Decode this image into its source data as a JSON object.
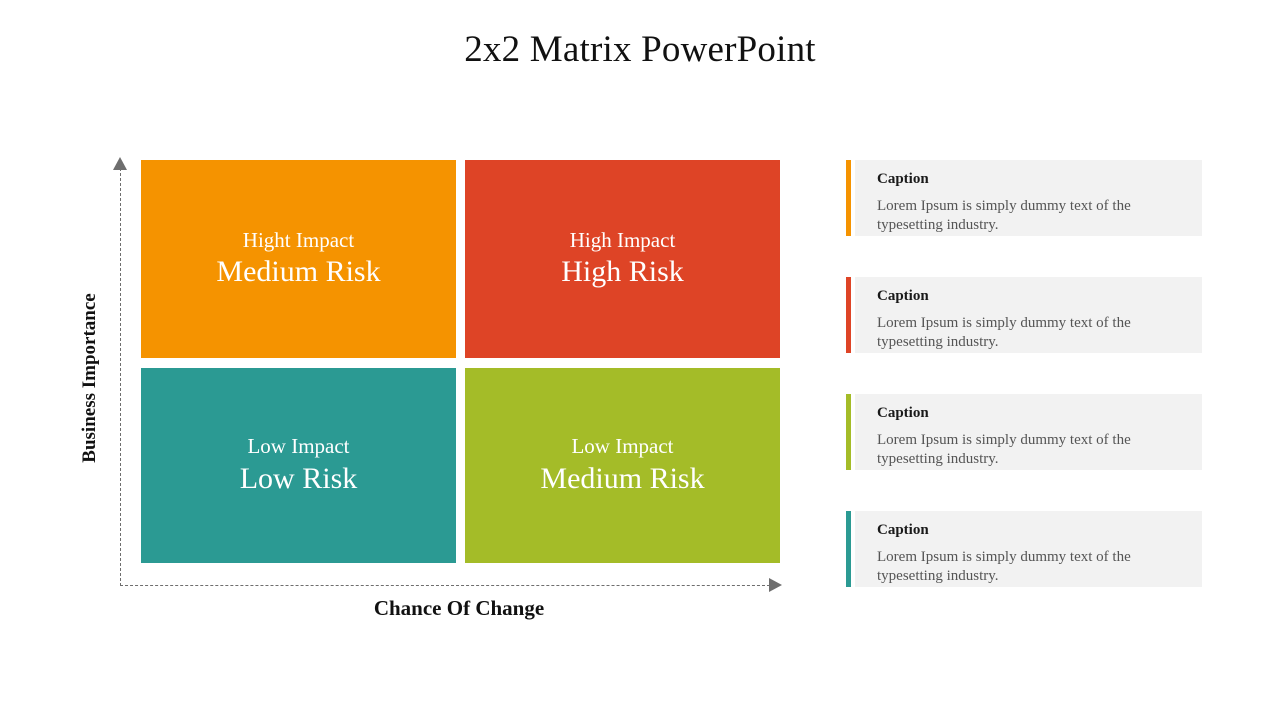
{
  "slide": {
    "title": "2x2 Matrix PowerPoint"
  },
  "axes": {
    "y_label": "Business Importance",
    "x_label": "Chance Of Change",
    "axis_line_color": "#6e6e6e"
  },
  "matrix": {
    "quadrants": [
      {
        "position": "top-left",
        "impact": "Hight Impact",
        "risk": "Medium Risk",
        "color": "#f59300"
      },
      {
        "position": "top-right",
        "impact": "High Impact",
        "risk": "High Risk",
        "color": "#de4426"
      },
      {
        "position": "bottom-left",
        "impact": "Low Impact",
        "risk": "Low Risk",
        "color": "#2b9a93"
      },
      {
        "position": "bottom-right",
        "impact": "Low Impact",
        "risk": "Medium Risk",
        "color": "#a4bc28"
      }
    ]
  },
  "captions": {
    "card_background": "#f2f2f2",
    "items": [
      {
        "title": "Caption",
        "text": "Lorem Ipsum is simply dummy text of the typesetting industry.",
        "accent": "#f59300"
      },
      {
        "title": "Caption",
        "text": "Lorem Ipsum is simply dummy text of the typesetting industry.",
        "accent": "#de4426"
      },
      {
        "title": "Caption",
        "text": "Lorem Ipsum is simply dummy text of the typesetting industry.",
        "accent": "#a4bc28"
      },
      {
        "title": "Caption",
        "text": "Lorem Ipsum is simply dummy text of the typesetting industry.",
        "accent": "#2b9a93"
      }
    ]
  }
}
